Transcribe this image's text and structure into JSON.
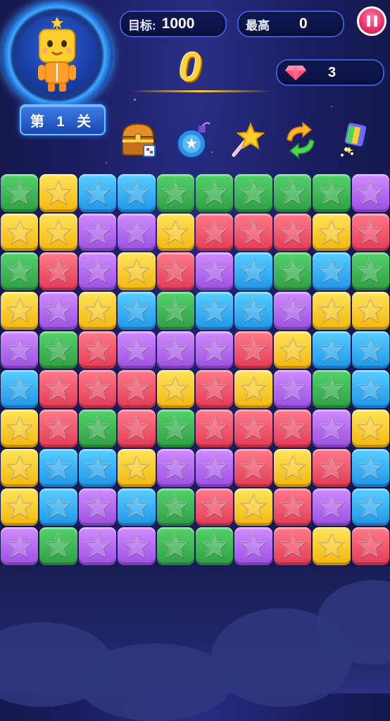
{
  "header": {
    "target_label": "目标:",
    "target_value": "1000",
    "best_label": "最高",
    "best_value": "0",
    "score": "0",
    "gems": "3",
    "level_text": "第 1 关"
  },
  "tools": [
    {
      "name": "treasure-chest-icon"
    },
    {
      "name": "bomb-icon"
    },
    {
      "name": "magic-wand-icon"
    },
    {
      "name": "refresh-arrows-icon"
    },
    {
      "name": "rainbow-paint-icon"
    }
  ],
  "colors": {
    "G": "#3fb955",
    "Y": "#f8c91f",
    "B": "#35b3f5",
    "P": "#b86df0",
    "R": "#f04f66"
  },
  "board": [
    [
      "G",
      "Y",
      "B",
      "B",
      "G",
      "G",
      "G",
      "G",
      "G",
      "P"
    ],
    [
      "Y",
      "Y",
      "P",
      "P",
      "Y",
      "R",
      "R",
      "R",
      "Y",
      "R"
    ],
    [
      "G",
      "R",
      "P",
      "Y",
      "R",
      "P",
      "B",
      "G",
      "B",
      "G"
    ],
    [
      "Y",
      "P",
      "Y",
      "B",
      "G",
      "B",
      "B",
      "P",
      "Y",
      "Y"
    ],
    [
      "P",
      "G",
      "R",
      "P",
      "P",
      "P",
      "R",
      "Y",
      "B",
      "B"
    ],
    [
      "B",
      "R",
      "R",
      "R",
      "Y",
      "R",
      "Y",
      "P",
      "G",
      "B"
    ],
    [
      "Y",
      "R",
      "G",
      "R",
      "G",
      "R",
      "R",
      "R",
      "P",
      "Y"
    ],
    [
      "Y",
      "B",
      "B",
      "Y",
      "P",
      "P",
      "R",
      "Y",
      "R",
      "B"
    ],
    [
      "Y",
      "B",
      "P",
      "B",
      "G",
      "R",
      "Y",
      "R",
      "P",
      "B"
    ],
    [
      "P",
      "G",
      "P",
      "P",
      "G",
      "G",
      "P",
      "R",
      "Y",
      "R"
    ]
  ]
}
